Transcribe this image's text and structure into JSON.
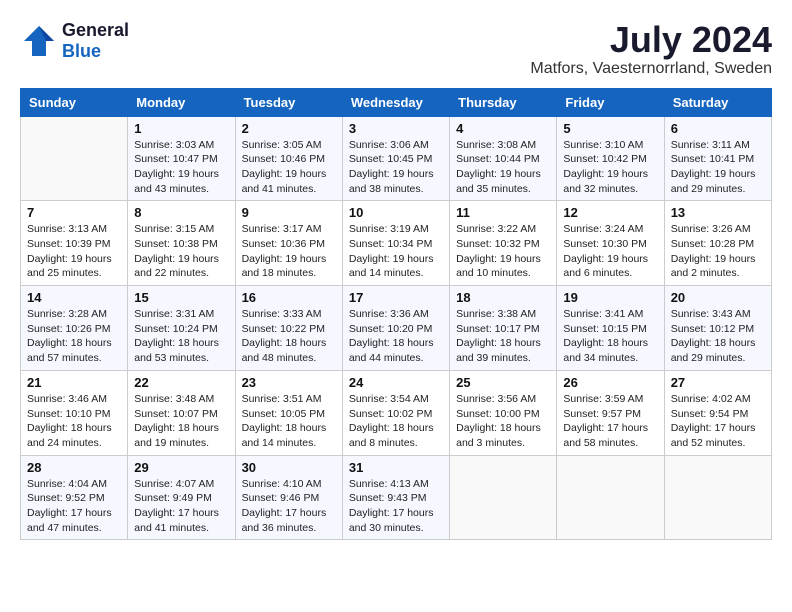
{
  "header": {
    "logo_line1": "General",
    "logo_line2": "Blue",
    "month_year": "July 2024",
    "location": "Matfors, Vaesternorrland, Sweden"
  },
  "weekdays": [
    "Sunday",
    "Monday",
    "Tuesday",
    "Wednesday",
    "Thursday",
    "Friday",
    "Saturday"
  ],
  "weeks": [
    [
      {
        "day": "",
        "sunrise": "",
        "sunset": "",
        "daylight": ""
      },
      {
        "day": "1",
        "sunrise": "Sunrise: 3:03 AM",
        "sunset": "Sunset: 10:47 PM",
        "daylight": "Daylight: 19 hours and 43 minutes."
      },
      {
        "day": "2",
        "sunrise": "Sunrise: 3:05 AM",
        "sunset": "Sunset: 10:46 PM",
        "daylight": "Daylight: 19 hours and 41 minutes."
      },
      {
        "day": "3",
        "sunrise": "Sunrise: 3:06 AM",
        "sunset": "Sunset: 10:45 PM",
        "daylight": "Daylight: 19 hours and 38 minutes."
      },
      {
        "day": "4",
        "sunrise": "Sunrise: 3:08 AM",
        "sunset": "Sunset: 10:44 PM",
        "daylight": "Daylight: 19 hours and 35 minutes."
      },
      {
        "day": "5",
        "sunrise": "Sunrise: 3:10 AM",
        "sunset": "Sunset: 10:42 PM",
        "daylight": "Daylight: 19 hours and 32 minutes."
      },
      {
        "day": "6",
        "sunrise": "Sunrise: 3:11 AM",
        "sunset": "Sunset: 10:41 PM",
        "daylight": "Daylight: 19 hours and 29 minutes."
      }
    ],
    [
      {
        "day": "7",
        "sunrise": "Sunrise: 3:13 AM",
        "sunset": "Sunset: 10:39 PM",
        "daylight": "Daylight: 19 hours and 25 minutes."
      },
      {
        "day": "8",
        "sunrise": "Sunrise: 3:15 AM",
        "sunset": "Sunset: 10:38 PM",
        "daylight": "Daylight: 19 hours and 22 minutes."
      },
      {
        "day": "9",
        "sunrise": "Sunrise: 3:17 AM",
        "sunset": "Sunset: 10:36 PM",
        "daylight": "Daylight: 19 hours and 18 minutes."
      },
      {
        "day": "10",
        "sunrise": "Sunrise: 3:19 AM",
        "sunset": "Sunset: 10:34 PM",
        "daylight": "Daylight: 19 hours and 14 minutes."
      },
      {
        "day": "11",
        "sunrise": "Sunrise: 3:22 AM",
        "sunset": "Sunset: 10:32 PM",
        "daylight": "Daylight: 19 hours and 10 minutes."
      },
      {
        "day": "12",
        "sunrise": "Sunrise: 3:24 AM",
        "sunset": "Sunset: 10:30 PM",
        "daylight": "Daylight: 19 hours and 6 minutes."
      },
      {
        "day": "13",
        "sunrise": "Sunrise: 3:26 AM",
        "sunset": "Sunset: 10:28 PM",
        "daylight": "Daylight: 19 hours and 2 minutes."
      }
    ],
    [
      {
        "day": "14",
        "sunrise": "Sunrise: 3:28 AM",
        "sunset": "Sunset: 10:26 PM",
        "daylight": "Daylight: 18 hours and 57 minutes."
      },
      {
        "day": "15",
        "sunrise": "Sunrise: 3:31 AM",
        "sunset": "Sunset: 10:24 PM",
        "daylight": "Daylight: 18 hours and 53 minutes."
      },
      {
        "day": "16",
        "sunrise": "Sunrise: 3:33 AM",
        "sunset": "Sunset: 10:22 PM",
        "daylight": "Daylight: 18 hours and 48 minutes."
      },
      {
        "day": "17",
        "sunrise": "Sunrise: 3:36 AM",
        "sunset": "Sunset: 10:20 PM",
        "daylight": "Daylight: 18 hours and 44 minutes."
      },
      {
        "day": "18",
        "sunrise": "Sunrise: 3:38 AM",
        "sunset": "Sunset: 10:17 PM",
        "daylight": "Daylight: 18 hours and 39 minutes."
      },
      {
        "day": "19",
        "sunrise": "Sunrise: 3:41 AM",
        "sunset": "Sunset: 10:15 PM",
        "daylight": "Daylight: 18 hours and 34 minutes."
      },
      {
        "day": "20",
        "sunrise": "Sunrise: 3:43 AM",
        "sunset": "Sunset: 10:12 PM",
        "daylight": "Daylight: 18 hours and 29 minutes."
      }
    ],
    [
      {
        "day": "21",
        "sunrise": "Sunrise: 3:46 AM",
        "sunset": "Sunset: 10:10 PM",
        "daylight": "Daylight: 18 hours and 24 minutes."
      },
      {
        "day": "22",
        "sunrise": "Sunrise: 3:48 AM",
        "sunset": "Sunset: 10:07 PM",
        "daylight": "Daylight: 18 hours and 19 minutes."
      },
      {
        "day": "23",
        "sunrise": "Sunrise: 3:51 AM",
        "sunset": "Sunset: 10:05 PM",
        "daylight": "Daylight: 18 hours and 14 minutes."
      },
      {
        "day": "24",
        "sunrise": "Sunrise: 3:54 AM",
        "sunset": "Sunset: 10:02 PM",
        "daylight": "Daylight: 18 hours and 8 minutes."
      },
      {
        "day": "25",
        "sunrise": "Sunrise: 3:56 AM",
        "sunset": "Sunset: 10:00 PM",
        "daylight": "Daylight: 18 hours and 3 minutes."
      },
      {
        "day": "26",
        "sunrise": "Sunrise: 3:59 AM",
        "sunset": "Sunset: 9:57 PM",
        "daylight": "Daylight: 17 hours and 58 minutes."
      },
      {
        "day": "27",
        "sunrise": "Sunrise: 4:02 AM",
        "sunset": "Sunset: 9:54 PM",
        "daylight": "Daylight: 17 hours and 52 minutes."
      }
    ],
    [
      {
        "day": "28",
        "sunrise": "Sunrise: 4:04 AM",
        "sunset": "Sunset: 9:52 PM",
        "daylight": "Daylight: 17 hours and 47 minutes."
      },
      {
        "day": "29",
        "sunrise": "Sunrise: 4:07 AM",
        "sunset": "Sunset: 9:49 PM",
        "daylight": "Daylight: 17 hours and 41 minutes."
      },
      {
        "day": "30",
        "sunrise": "Sunrise: 4:10 AM",
        "sunset": "Sunset: 9:46 PM",
        "daylight": "Daylight: 17 hours and 36 minutes."
      },
      {
        "day": "31",
        "sunrise": "Sunrise: 4:13 AM",
        "sunset": "Sunset: 9:43 PM",
        "daylight": "Daylight: 17 hours and 30 minutes."
      },
      {
        "day": "",
        "sunrise": "",
        "sunset": "",
        "daylight": ""
      },
      {
        "day": "",
        "sunrise": "",
        "sunset": "",
        "daylight": ""
      },
      {
        "day": "",
        "sunrise": "",
        "sunset": "",
        "daylight": ""
      }
    ]
  ]
}
